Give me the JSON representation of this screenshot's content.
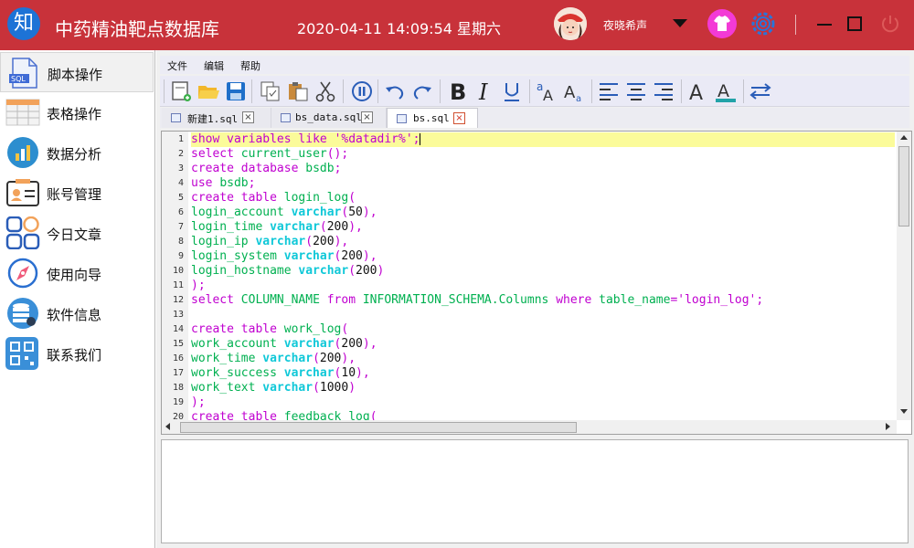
{
  "app": {
    "logo_char": "知",
    "title": "中药精油靶点数据库",
    "datetime": "2020-04-11 14:09:54 星期六",
    "username": "夜晓希声",
    "close_glyph": "⏻"
  },
  "colors": {
    "titlebar": "#c8323a",
    "accent_blue": "#1d73d6",
    "skin_button": "#f33ad6",
    "keyword": "#c000d0",
    "identifier": "#00b050",
    "type": "#10c8d8",
    "highlight_line": "#fbfb9a"
  },
  "sidebar": {
    "items": [
      {
        "label": "脚本操作",
        "icon": "sql-file-icon",
        "active": true
      },
      {
        "label": "表格操作",
        "icon": "table-icon"
      },
      {
        "label": "数据分析",
        "icon": "chart-icon"
      },
      {
        "label": "账号管理",
        "icon": "id-card-icon"
      },
      {
        "label": "今日文章",
        "icon": "apps-grid-icon"
      },
      {
        "label": "使用向导",
        "icon": "compass-icon"
      },
      {
        "label": "软件信息",
        "icon": "database-gear-icon"
      },
      {
        "label": "联系我们",
        "icon": "qr-code-icon"
      }
    ]
  },
  "menu": {
    "items": [
      "文件",
      "编辑",
      "帮助"
    ]
  },
  "toolbar": {
    "buttons": [
      "new-file-icon",
      "open-folder-icon",
      "save-icon",
      "copy-icon",
      "paste-icon",
      "cut-icon",
      "pause-icon",
      "undo-icon",
      "redo-icon",
      "bold-icon",
      "italic-icon",
      "underline-icon",
      "font-case-icon",
      "font-size-icon",
      "align-left-icon",
      "align-center-icon",
      "align-right-icon",
      "font-icon",
      "font-color-icon",
      "swap-icon"
    ]
  },
  "tabs": [
    {
      "label": "新建1.sql"
    },
    {
      "label": "bs_data.sql"
    },
    {
      "label": "bs.sql",
      "active": true
    }
  ],
  "editor": {
    "line_numbers": [
      "1",
      "2",
      "3",
      "4",
      "5",
      "6",
      "7",
      "8",
      "9",
      "10",
      "11",
      "12",
      "13",
      "14",
      "15",
      "16",
      "17",
      "18",
      "19",
      "20"
    ],
    "lines": [
      "show variables like '%datadir%';",
      "select current_user();",
      "create database bsdb;",
      "use bsdb;",
      "create table login_log(",
      "login_account varchar(50),",
      "login_time varchar(200),",
      "login_ip varchar(200),",
      "login_system varchar(200),",
      "login_hostname varchar(200)",
      ");",
      "select COLUMN_NAME from INFORMATION_SCHEMA.Columns where table_name='login_log';",
      "",
      "create table work_log(",
      "work_account varchar(200),",
      "work_time varchar(200),",
      "work_success varchar(10),",
      "work_text varchar(1000)",
      ");",
      "create table feedback_log("
    ]
  }
}
